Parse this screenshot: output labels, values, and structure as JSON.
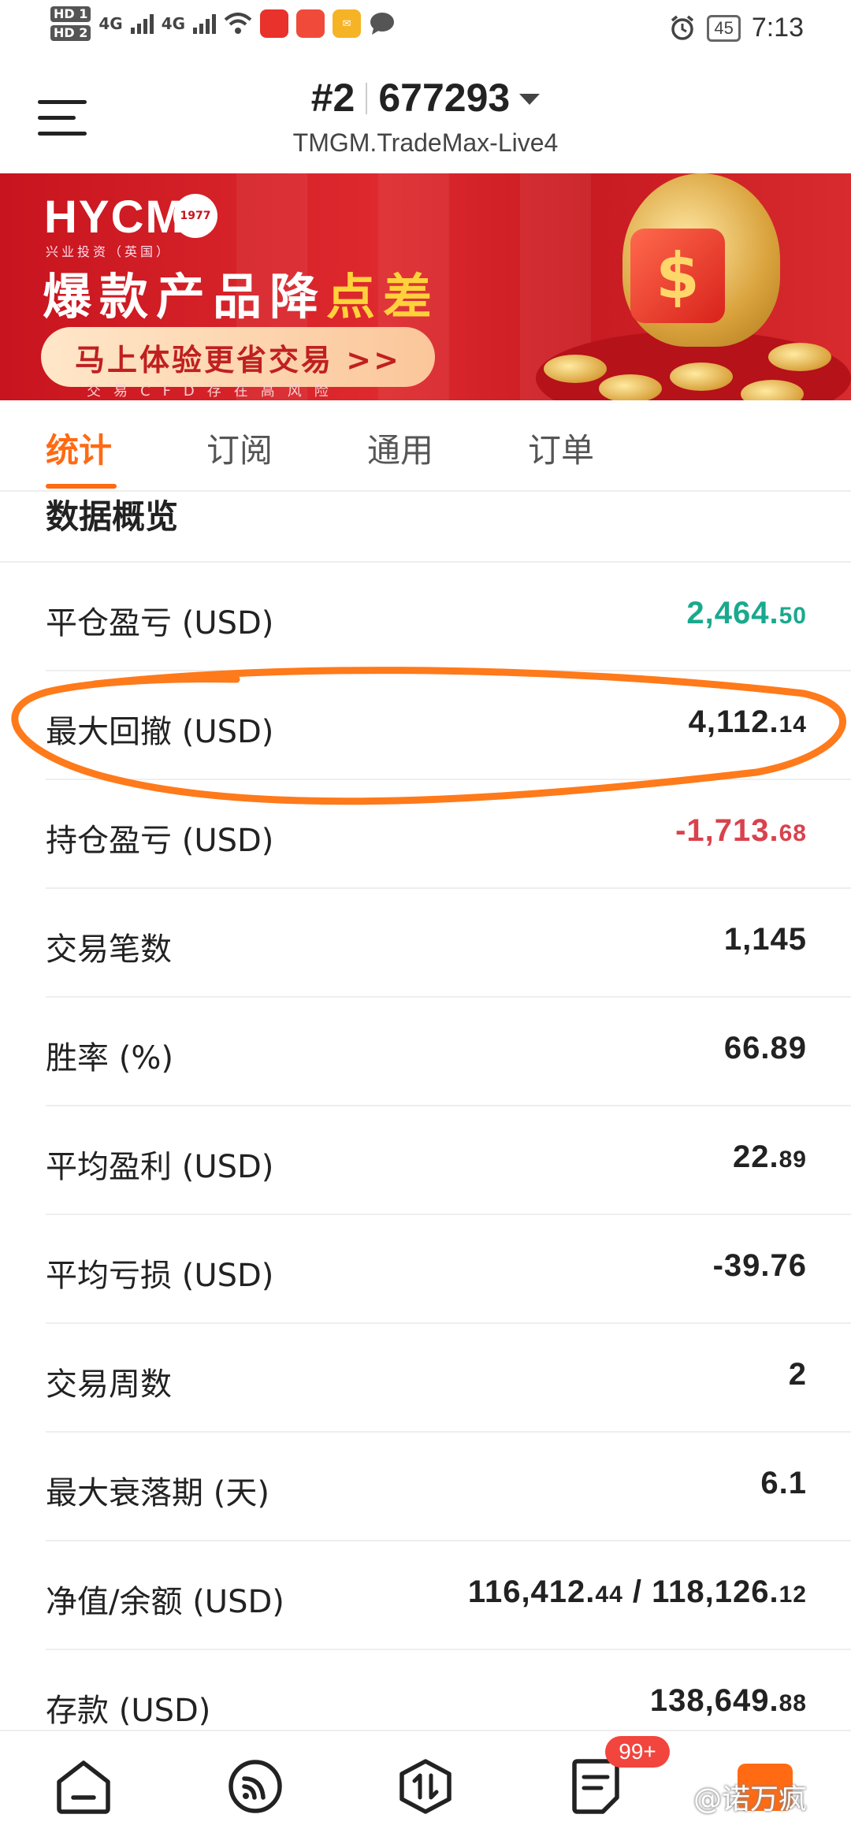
{
  "status_bar": {
    "sim1": "HD 1",
    "sim2": "HD 2",
    "net1": "4G",
    "net2": "4G",
    "battery": "45",
    "time": "7:13"
  },
  "header": {
    "account_index": "#2",
    "account_number": "677293",
    "server": "TMGM.TradeMax-Live4"
  },
  "banner": {
    "logo": "HYCM",
    "logo_sub": "兴业投资（英国）",
    "seal": "1977",
    "headline_plain": "爆款产品降",
    "headline_highlight": "点差",
    "cta": "马上体验更省交易 >>",
    "risk_notice": "交易CFD存在高风险"
  },
  "tabs": [
    {
      "label": "统计",
      "active": true
    },
    {
      "label": "订阅",
      "active": false
    },
    {
      "label": "通用",
      "active": false
    },
    {
      "label": "订单",
      "active": false
    }
  ],
  "section_title": "数据概览",
  "stats": [
    {
      "label": "平仓盈亏 (USD)",
      "int": "2,464.",
      "dec": "50",
      "color": "#1aa98e"
    },
    {
      "label": "最大回撤 (USD)",
      "int": "4,112.",
      "dec": "14",
      "color": "#222222"
    },
    {
      "label": "持仓盈亏 (USD)",
      "int": "-1,713.",
      "dec": "68",
      "color": "#d9424d"
    },
    {
      "label": "交易笔数",
      "int": "1,145",
      "dec": "",
      "color": "#222222"
    },
    {
      "label": "胜率 (%)",
      "int": "66.89",
      "dec": "",
      "color": "#222222"
    },
    {
      "label": "平均盈利 (USD)",
      "int": "22.",
      "dec": "89",
      "color": "#222222"
    },
    {
      "label": "平均亏损 (USD)",
      "int": "-39.76",
      "dec": "",
      "color": "#222222"
    },
    {
      "label": "交易周数",
      "int": "2",
      "dec": "",
      "color": "#222222"
    },
    {
      "label": "最大衰落期 (天)",
      "int": "6.1",
      "dec": "",
      "color": "#222222"
    },
    {
      "label": "净值/余额 (USD)",
      "int": "116,412.",
      "dec": "44",
      "int2": " / 118,126.",
      "dec2": "12",
      "color": "#222222"
    },
    {
      "label": "存款 (USD)",
      "int": "138,649.",
      "dec": "88",
      "color": "#222222"
    }
  ],
  "bottom_nav": {
    "badge": "99+",
    "watermark": "@诺万疯",
    "items": [
      "home-icon",
      "signal-icon",
      "trade-icon",
      "notes-icon"
    ]
  },
  "colors": {
    "accent": "#ff6a13",
    "profit": "#1aa98e",
    "loss": "#d9424d",
    "annotation": "#ff7a1a"
  }
}
